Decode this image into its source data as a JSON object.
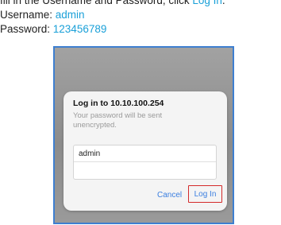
{
  "instructions": {
    "line1_prefix": "fill in the Username and Password, click ",
    "line1_link": "Log In",
    "line1_suffix": ".",
    "username_label": "Username: ",
    "username_value": "admin",
    "password_label": "Password: ",
    "password_value": "123456789"
  },
  "dialog": {
    "title": "Log in to 10.10.100.254",
    "message": "Your password will be sent unencrypted.",
    "username_value": "admin",
    "password_value": "",
    "cancel_label": "Cancel",
    "login_label": "Log In"
  },
  "colors": {
    "link": "#1aa0d8",
    "button_text": "#3b7fe0",
    "highlight_box": "#d42a2a",
    "screenshot_border": "#3e7fd0"
  }
}
